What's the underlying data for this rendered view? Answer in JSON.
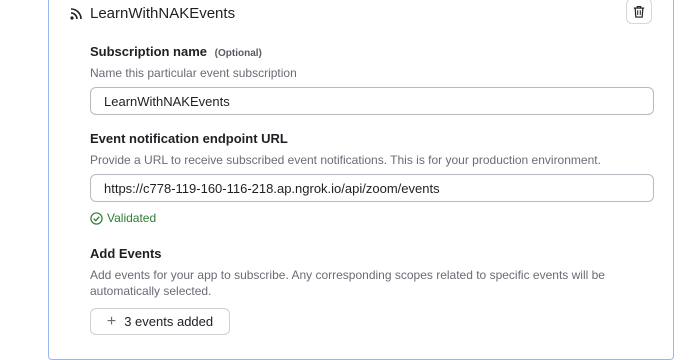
{
  "subscription": {
    "title": "LearnWithNAKEvents",
    "icon": "rss-icon",
    "delete_icon": "trash-icon"
  },
  "name_field": {
    "label": "Subscription name",
    "optional": "(Optional)",
    "description": "Name this particular event subscription",
    "value": "LearnWithNAKEvents"
  },
  "endpoint_field": {
    "label": "Event notification endpoint URL",
    "description": "Provide a URL to receive subscribed event notifications. This is for your production environment.",
    "value": "https://c778-119-160-116-218.ap.ngrok.io/api/zoom/events",
    "status": "Validated",
    "status_color": "#2e7d32"
  },
  "events": {
    "label": "Add Events",
    "description": "Add events for your app to subscribe. Any corresponding scopes related to specific events will be automatically selected.",
    "button_label": "3 events added"
  },
  "colors": {
    "card_border": "#9ab6f0"
  }
}
